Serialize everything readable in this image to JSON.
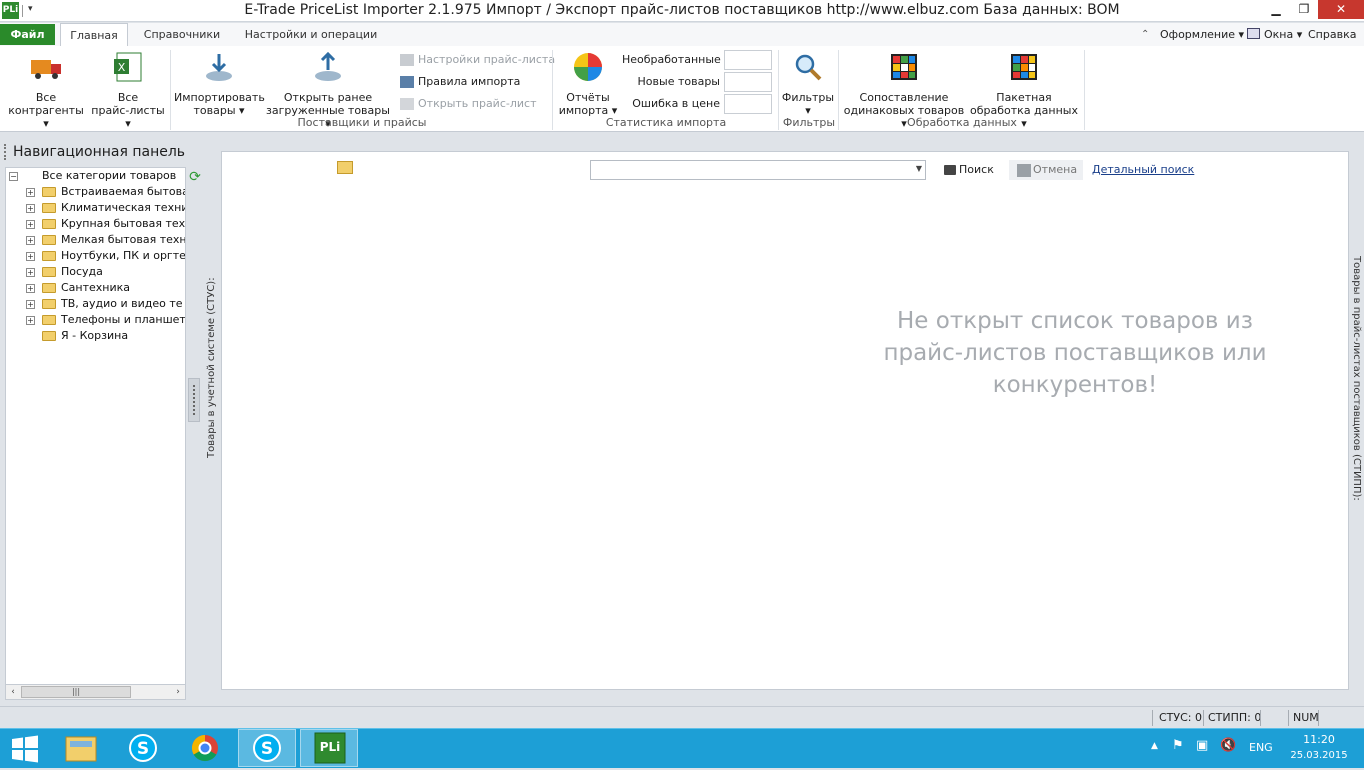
{
  "window": {
    "title": "E-Trade PriceList Importer 2.1.975     Импорт / Экспорт прайс-листов поставщиков     http://www.elbuz.com     База данных: BOM",
    "app_icon": "PLi"
  },
  "tabs": {
    "file": "Файл",
    "main": "Главная",
    "references": "Справочники",
    "settings": "Настройки и операции"
  },
  "top_menu": {
    "design": "Оформление",
    "windows": "Окна",
    "help": "Справка"
  },
  "ribbon": {
    "all_contractors": [
      "Все",
      "контрагенты"
    ],
    "all_pricelists": [
      "Все",
      "прайс-листы"
    ],
    "import_goods": [
      "Импортировать",
      "товары"
    ],
    "open_loaded": [
      "Открыть ранее",
      "загруженные товары"
    ],
    "pricelist_settings": "Настройки прайс-листа",
    "import_rules": "Правила импорта",
    "open_pricelist": "Открыть прайс-лист",
    "group_suppliers": "Поставщики и прайсы",
    "import_reports": [
      "Отчёты",
      "импорта"
    ],
    "stat_unprocessed": "Необработанные",
    "stat_new": "Новые товары",
    "stat_price_error": "Ошибка в цене",
    "group_stats": "Статистика импорта",
    "filters": "Фильтры",
    "group_filters": "Фильтры",
    "match_goods": [
      "Сопоставление",
      "одинаковых товаров"
    ],
    "batch_processing": [
      "Пакетная",
      "обработка данных"
    ],
    "group_data": "Обработка данных"
  },
  "nav": {
    "title": "Навигационная панель",
    "root": "Все категории товаров",
    "items": [
      "Встраиваемая бытова",
      "Климатическая техни",
      "Крупная бытовая техн",
      "Мелкая бытовая техн",
      "Ноутбуки, ПК и оргте",
      "Посуда",
      "Сантехника",
      "ТВ, аудио и видео те",
      "Телефоны и планшет"
    ],
    "leaf": "Я - Корзина"
  },
  "side_labels": {
    "left": "Товары в учетной системе (СТУС):",
    "right": "Товары в прайс-листах поставщиков (СТИПП):"
  },
  "main": {
    "search_value": "",
    "search_button": "Поиск",
    "cancel_button": "Отмена",
    "advanced_search": "Детальный поиск",
    "empty_message": [
      "Не открыт список товаров из",
      "прайс-листов поставщиков или",
      "конкурентов!"
    ]
  },
  "status": {
    "stus": "СТУС: 0",
    "stipp": "СТИПП: 0",
    "num": "NUM"
  },
  "taskbar": {
    "lang": "ENG",
    "time": "11:20",
    "date": "25.03.2015"
  }
}
